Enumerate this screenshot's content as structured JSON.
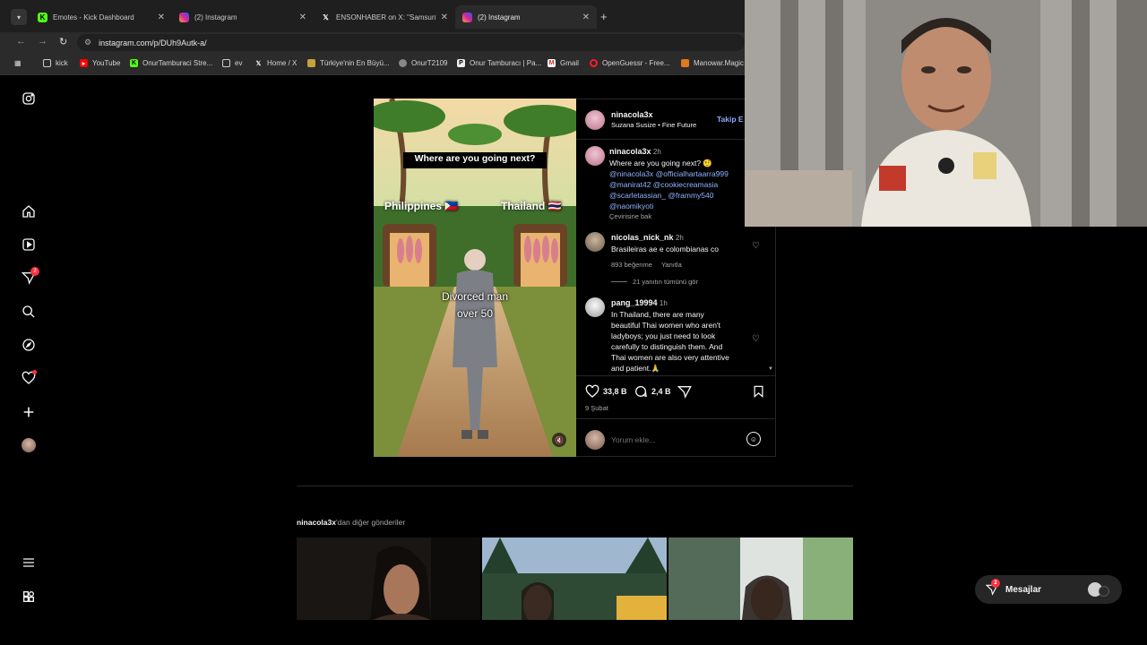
{
  "browser": {
    "tabs": [
      {
        "label": "Emotes - Kick Dashboard",
        "icon": "kick-icon"
      },
      {
        "label": "(2) Instagram",
        "icon": "instagram-icon"
      },
      {
        "label": "ENSONHABER on X: \"Samsun'd",
        "icon": "x-icon"
      },
      {
        "label": "(2) Instagram",
        "icon": "instagram-icon"
      }
    ],
    "new_tab": "+",
    "url": "instagram.com/p/DUh9Autk-a/",
    "bookmarks": [
      {
        "label": "kick",
        "icon": "folder-icon"
      },
      {
        "label": "YouTube",
        "icon": "youtube-icon"
      },
      {
        "label": "OnurTamburaci Stre...",
        "icon": "kick-icon"
      },
      {
        "label": "ev",
        "icon": "folder-icon"
      },
      {
        "label": "Home / X",
        "icon": "x-icon"
      },
      {
        "label": "Türkiye'nin En Büyü...",
        "icon": "site-icon"
      },
      {
        "label": "OnurT2109",
        "icon": "site-icon"
      },
      {
        "label": "Onur Tamburacı | Pa...",
        "icon": "site-icon"
      },
      {
        "label": "Gmail",
        "icon": "gmail-icon"
      },
      {
        "label": "OpenGuessr - Free...",
        "icon": "opera-icon"
      },
      {
        "label": "Manowar.Magic",
        "icon": "site-icon"
      }
    ]
  },
  "sidebar": {
    "notifications_badge": "2"
  },
  "post": {
    "overlay": {
      "headline": "Where are you going next?",
      "left_label": "Philippines 🇵🇭",
      "right_label": "Thailand 🇹🇭",
      "center_label_line1": "Divorced man",
      "center_label_line2": "over 50"
    },
    "author": {
      "username": "ninacola3x",
      "audio": "Suzana Susize • Fine Future",
      "follow_label": "Takip E"
    },
    "caption": {
      "username": "ninacola3x",
      "time": "2h",
      "text": "Where are you going next? 🤨",
      "mentions": [
        "@ninacola3x @officialhartaarra999",
        "@manirat42 @cookiecreamasia",
        "@scarletassian_ @frammy540",
        "@naomikyoti"
      ],
      "translate": "Çevirisine bak"
    },
    "comments": [
      {
        "username": "nicolas_nick_nk",
        "time": "2h",
        "text": "Brasileiras ae e colombianas co",
        "likes": "893 beğenme",
        "reply": "Yanıtla",
        "view_replies": "21 yanıtın tümünü gör"
      },
      {
        "username": "pang_19994",
        "time": "1h",
        "lines": [
          "In Thailand, there are many",
          "beautiful Thai women who aren't",
          "ladyboys; you just need to look",
          "carefully to distinguish them. And",
          "Thai women are also very attentive",
          "and patient.🙏"
        ]
      }
    ],
    "actions": {
      "like_count": "33,8 B",
      "comment_count": "2,4 B"
    },
    "date": "9 Şubat",
    "comment_placeholder": "Yorum ekle..."
  },
  "more_posts": {
    "username": "ninacola3x",
    "suffix": "'dan diğer gönderiler"
  },
  "messages": {
    "label": "Mesajlar",
    "badge": "2"
  },
  "colors": {
    "instagram_accent": "#0095f6",
    "badge_red": "#ff3040",
    "kick_green": "#53fc18"
  }
}
